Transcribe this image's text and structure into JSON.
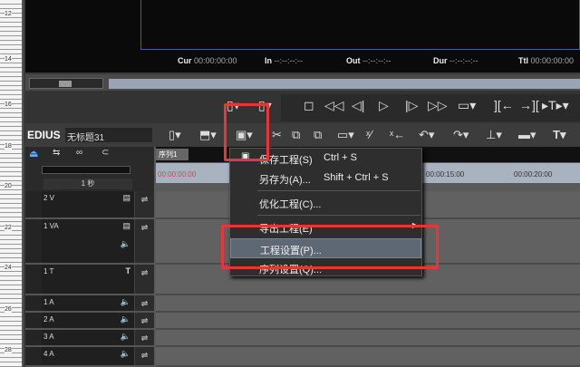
{
  "ruler_labels": [
    "12",
    "14",
    "16",
    "18",
    "20",
    "22",
    "24",
    "26",
    "28"
  ],
  "timecodes": {
    "cur_label": "Cur",
    "cur": "00:00:00:00",
    "in_label": "In",
    "in": "--:--:--:--",
    "out_label": "Out",
    "out": "--:--:--:--",
    "dur_label": "Dur",
    "dur": "--:--:--:--",
    "ttl_label": "Ttl",
    "ttl": "00:00:00:00"
  },
  "app": {
    "brand": "EDIUS",
    "project_name": "无标题31"
  },
  "timeline": {
    "sequence_tab": "序列1",
    "scale": "1 秒",
    "times": [
      "00:00:00:00",
      "00:00:15:00",
      "00:00:20:00"
    ]
  },
  "tracks": [
    {
      "name": "2 V"
    },
    {
      "name": "1 VA"
    },
    {
      "name": "1 T"
    },
    {
      "name": "1 A"
    },
    {
      "name": "2 A"
    },
    {
      "name": "3 A"
    },
    {
      "name": "4 A"
    }
  ],
  "menu": {
    "items": [
      {
        "label": "保存工程(S)",
        "shortcut": "Ctrl + S"
      },
      {
        "label": "另存为(A)...",
        "shortcut": "Shift + Ctrl + S"
      },
      {
        "label": "优化工程(C)..."
      },
      {
        "label": "导出工程(E)"
      },
      {
        "label": "工程设置(P)..."
      },
      {
        "label": "序列设置(Q)..."
      }
    ]
  },
  "colors": {
    "highlight": "#e8343a"
  }
}
